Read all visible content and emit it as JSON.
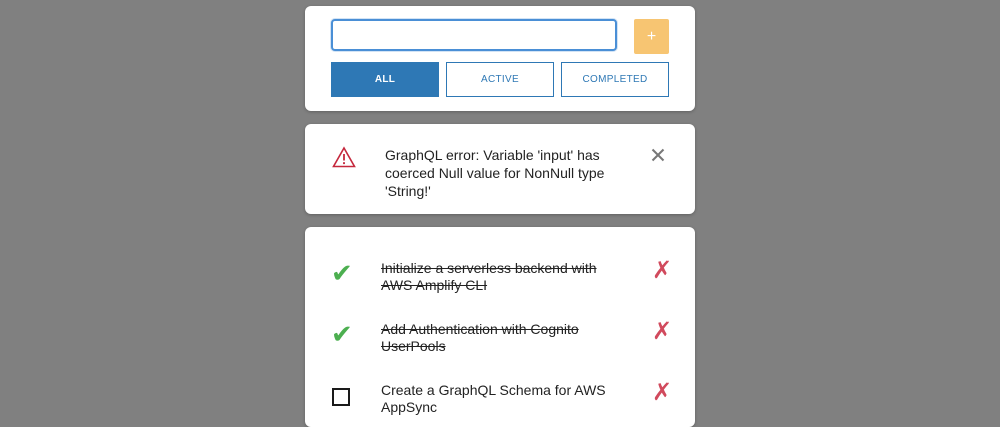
{
  "new_todo": {
    "value": "",
    "placeholder": "",
    "add_label": "+"
  },
  "filters": [
    {
      "label": "ALL",
      "selected": true
    },
    {
      "label": "ACTIVE",
      "selected": false
    },
    {
      "label": "COMPLETED",
      "selected": false
    }
  ],
  "error": {
    "message": "GraphQL error: Variable 'input' has coerced Null value for NonNull type 'String!'",
    "icon": "warning-triangle-icon"
  },
  "todos": [
    {
      "text": "Initialize a serverless backend with AWS Amplify CLI",
      "completed": true
    },
    {
      "text": "Add Authentication with Cognito UserPools",
      "completed": true
    },
    {
      "text": "Create a GraphQL Schema for AWS AppSync",
      "completed": false
    }
  ],
  "glyphs": {
    "check": "✔",
    "delete": "✗"
  },
  "colors": {
    "background": "#808080",
    "primary": "#2e78b5",
    "add_button": "#f7c572",
    "check": "#4caf50",
    "delete": "#d14a5d",
    "warning": "#c5283d"
  }
}
